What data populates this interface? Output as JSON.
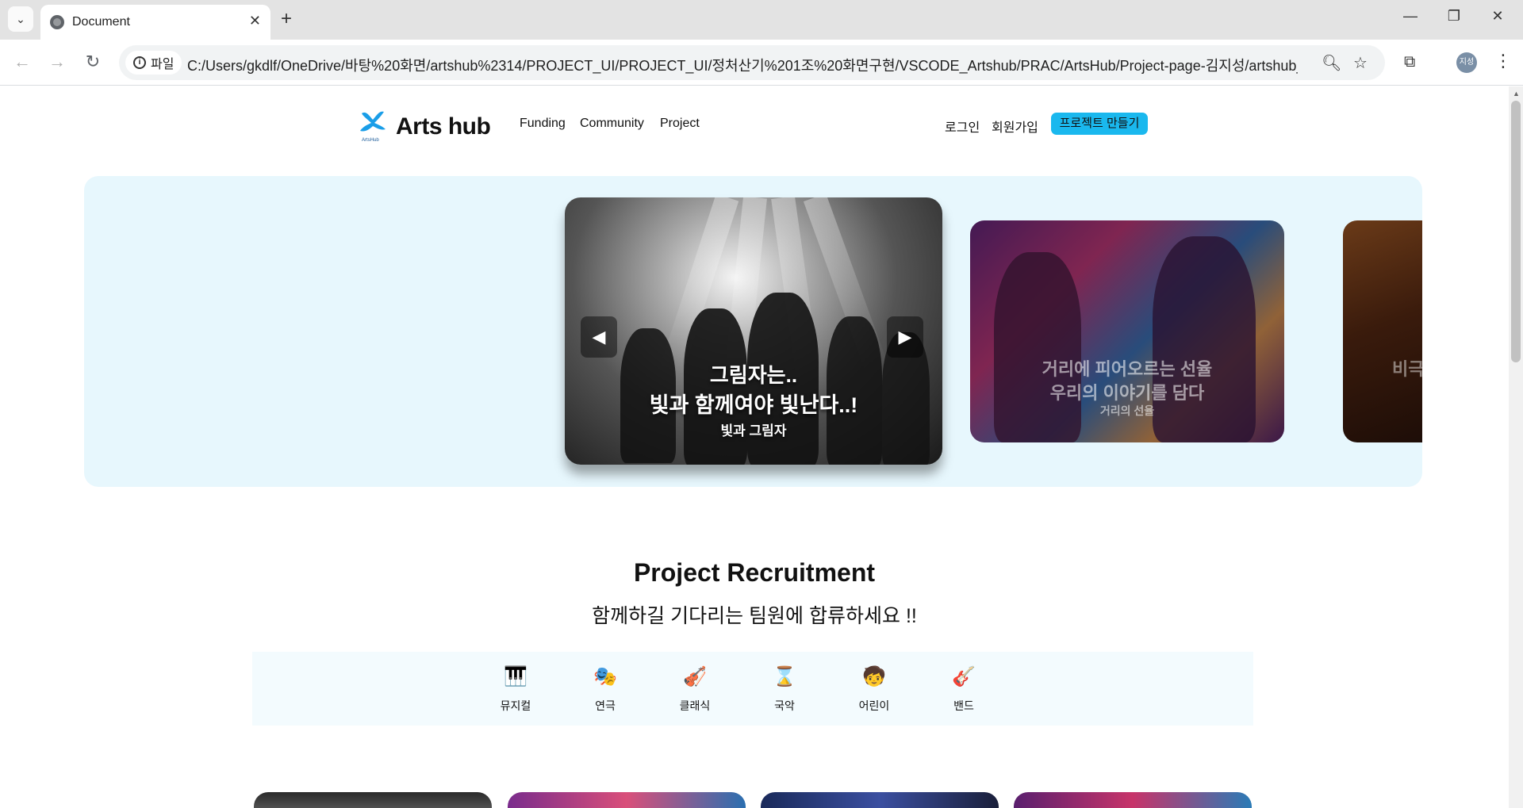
{
  "browser": {
    "tab_title": "Document",
    "site_chip": "파일",
    "url": "C:/Users/gkdlf/OneDrive/바탕%20화면/artshub%2314/PROJECT_UI/PROJECT_UI/정처산기%201조%20화면구현/VSCODE_Artshub/PRAC/ArtsHub/Project-page-김지성/artshub_pro...",
    "profile_initials": "지성"
  },
  "header": {
    "brand": "Arts hub",
    "logo_caption": "ArtsHub",
    "nav": [
      "Funding",
      "Community",
      "Project"
    ],
    "login": "로그인",
    "signup": "회원가입",
    "cta": "프로젝트 만들기"
  },
  "hero": {
    "main_slide": {
      "line1": "그림자는..",
      "line2": "빛과 함께여야 빛난다..!",
      "subtitle": "빛과 그림자"
    },
    "second_slide": {
      "line1": "거리에 피어오르는 선율",
      "line2": "우리의 이야기를 담다",
      "subtitle": "거리의 선율"
    },
    "third_slide": {
      "partial_text": "비극"
    }
  },
  "recruitment": {
    "title": "Project Recruitment",
    "subtitle": "함께하길 기다리는 팀원에 합류하세요 !!",
    "categories": [
      {
        "label": "뮤지컬",
        "icon": "piano-icon"
      },
      {
        "label": "연극",
        "icon": "theater-icon"
      },
      {
        "label": "클래식",
        "icon": "violin-icon"
      },
      {
        "label": "국악",
        "icon": "traditional-music-icon"
      },
      {
        "label": "어린이",
        "icon": "child-icon"
      },
      {
        "label": "밴드",
        "icon": "guitar-icon"
      }
    ]
  },
  "colors": {
    "accent": "#1ab8ee",
    "hero_bg": "#e7f7fd",
    "category_bg": "#f3fbfe"
  }
}
